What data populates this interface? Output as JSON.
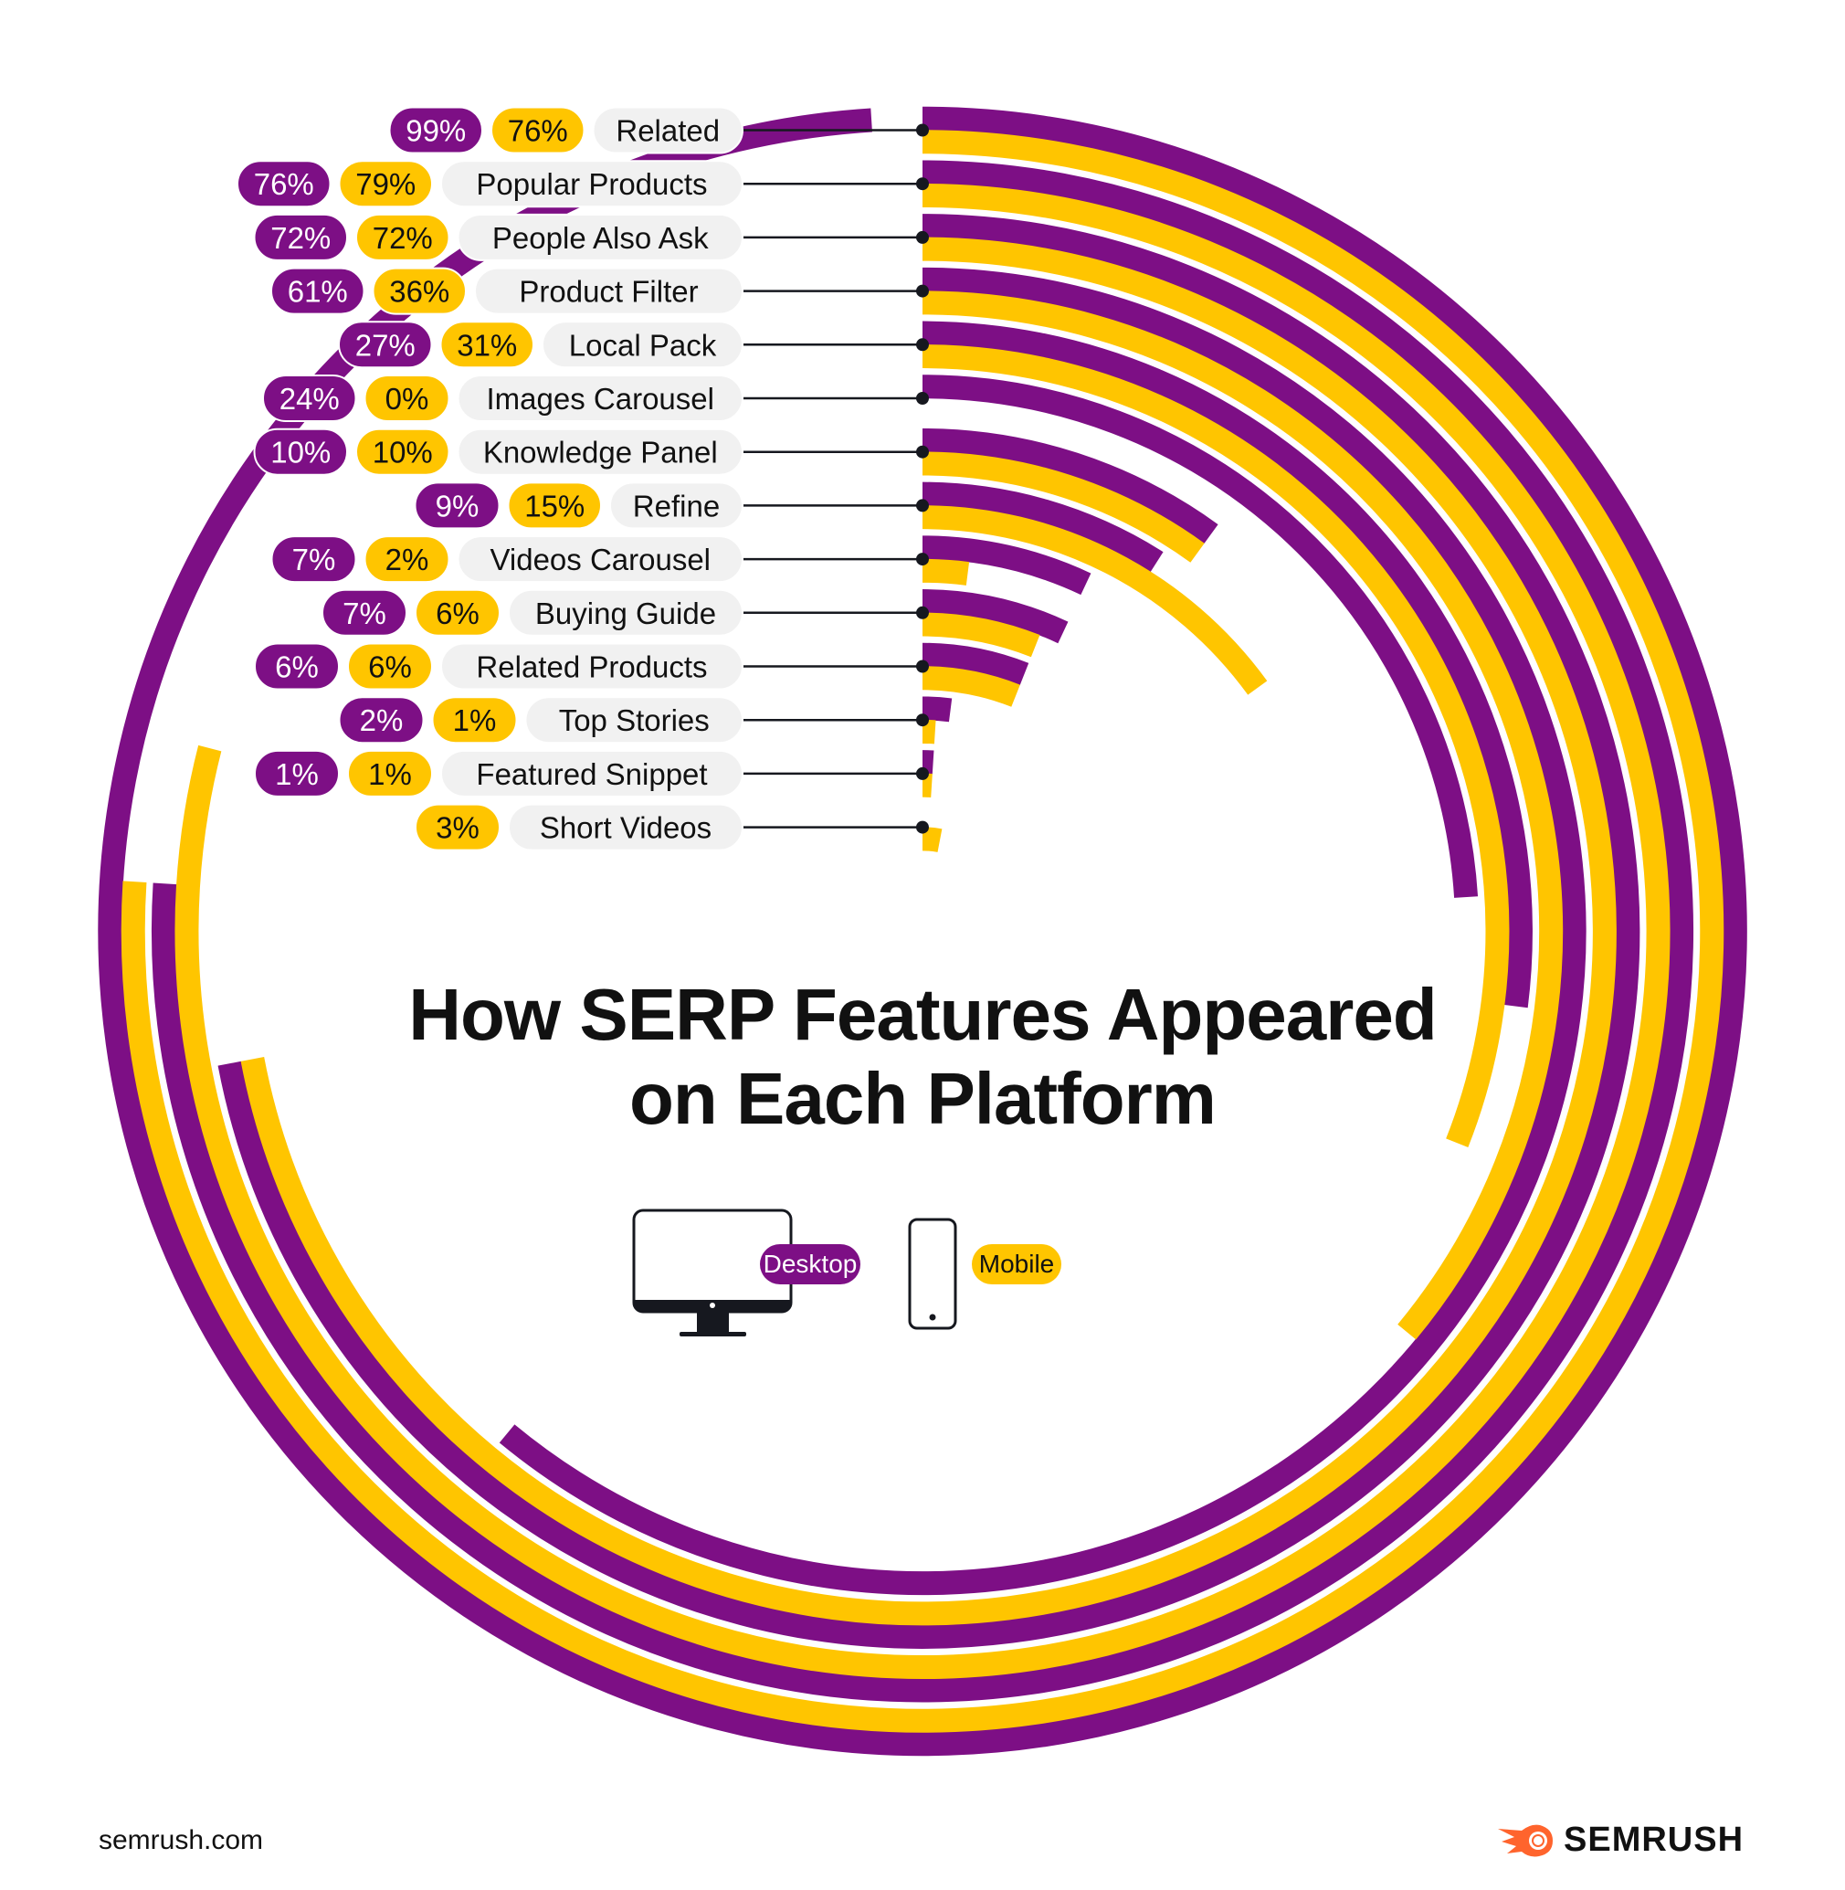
{
  "chart_data": {
    "type": "radial-bar",
    "title": "How SERP Features Appeared on Each Platform",
    "title_lines": [
      "How SERP Features Appeared",
      "on Each Platform"
    ],
    "value_range": [
      0,
      100
    ],
    "unit": "%",
    "start_angle": "12 o'clock, clockwise",
    "categories": [
      "Related",
      "Popular Products",
      "People Also Ask",
      "Product Filter",
      "Local Pack",
      "Images Carousel",
      "Knowledge Panel",
      "Refine",
      "Videos Carousel",
      "Buying Guide",
      "Related Products",
      "Top Stories",
      "Featured Snippet",
      "Short Videos"
    ],
    "series": [
      {
        "name": "Desktop",
        "color": "#7D0F85",
        "values": [
          99,
          76,
          72,
          61,
          27,
          24,
          10,
          9,
          7,
          7,
          6,
          2,
          1,
          null
        ],
        "labels": [
          "99%",
          "76%",
          "72%",
          "61%",
          "27%",
          "24%",
          "10%",
          "9%",
          "7%",
          "7%",
          "6%",
          "2%",
          "1%",
          null
        ]
      },
      {
        "name": "Mobile",
        "color": "#FFC500",
        "values": [
          76,
          79,
          72,
          36,
          31,
          0,
          10,
          15,
          2,
          6,
          6,
          1,
          1,
          3
        ],
        "labels": [
          "76%",
          "79%",
          "72%",
          "36%",
          "31%",
          "0%",
          "10%",
          "15%",
          "2%",
          "6%",
          "6%",
          "1%",
          "1%",
          "3%"
        ]
      }
    ],
    "legend": [
      {
        "label": "Desktop",
        "icon": "desktop-monitor-icon",
        "color": "#7D0F85"
      },
      {
        "label": "Mobile",
        "icon": "mobile-phone-icon",
        "color": "#FFC500"
      }
    ],
    "legend_position": "center"
  },
  "colors": {
    "desktop": "#7D0F85",
    "mobile": "#FFC500",
    "label_bg": "#F1F1F1",
    "ink": "#16181F",
    "brand": "#FF642D"
  },
  "footer": {
    "url": "semrush.com",
    "brand": "SEMRUSH"
  }
}
